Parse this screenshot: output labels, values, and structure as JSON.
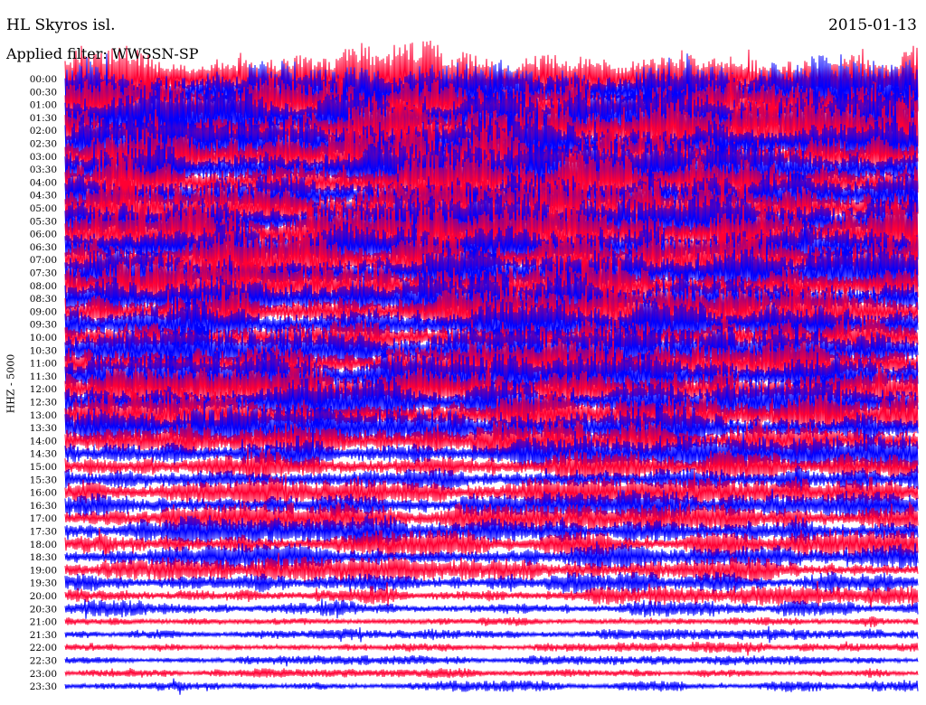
{
  "header": {
    "station": "HL Skyros isl.",
    "date": "2015-01-13",
    "filter": "Applied filter: WWSSN-SP"
  },
  "colors": {
    "trace_a": "#ff0033",
    "trace_b": "#0000ff",
    "background": "#ffffff"
  },
  "chart_data": {
    "type": "line",
    "title": "HL Skyros isl.",
    "subtitle": "Applied filter: WWSSN-SP",
    "date": "2015-01-13",
    "ylabel": "HHZ - 5000",
    "xlabel": "",
    "rows": [
      "00:00",
      "00:30",
      "01:00",
      "01:30",
      "02:00",
      "02:30",
      "03:00",
      "03:30",
      "04:00",
      "04:30",
      "05:00",
      "05:30",
      "06:00",
      "06:30",
      "07:00",
      "07:30",
      "08:00",
      "08:30",
      "09:00",
      "09:30",
      "10:00",
      "10:30",
      "11:00",
      "11:30",
      "12:00",
      "12:30",
      "13:00",
      "13:30",
      "14:00",
      "14:30",
      "15:00",
      "15:30",
      "16:00",
      "16:30",
      "17:00",
      "17:30",
      "18:00",
      "18:30",
      "19:00",
      "19:30",
      "20:00",
      "20:30",
      "21:00",
      "21:30",
      "22:00",
      "22:30",
      "23:00",
      "23:30"
    ],
    "series_colors": [
      "#ff0033",
      "#0000ff"
    ],
    "amplitude_trend": [
      2.6,
      2.6,
      2.5,
      2.5,
      2.4,
      2.4,
      2.4,
      2.3,
      2.3,
      2.3,
      2.2,
      2.2,
      2.2,
      2.1,
      2.1,
      2.0,
      2.0,
      2.0,
      1.9,
      1.9,
      1.9,
      1.9,
      1.8,
      1.8,
      1.8,
      1.7,
      1.7,
      1.6,
      1.5,
      1.3,
      1.2,
      1.2,
      1.1,
      1.1,
      1.1,
      1.1,
      1.0,
      1.0,
      0.9,
      0.8,
      0.7,
      0.6,
      0.45,
      0.4,
      0.4,
      0.35,
      0.35,
      0.4
    ],
    "grid": false,
    "legend": "none"
  }
}
